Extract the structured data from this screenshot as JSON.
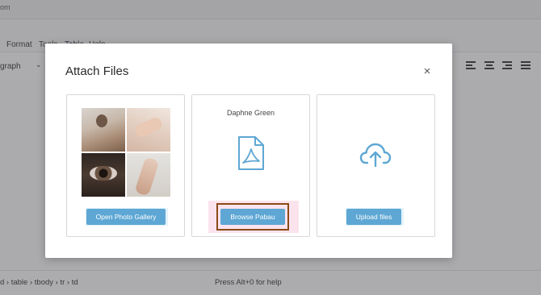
{
  "background": {
    "url_fragment": "om",
    "menus": [
      "Format",
      "Tools",
      "Table",
      "Help"
    ],
    "paragraph_select": "graph",
    "status_path": "d › table › tbody › tr › td",
    "status_help": "Press Alt+0 for help"
  },
  "modal": {
    "title": "Attach Files",
    "close_label": "×",
    "gallery_button": "Open Photo Gallery",
    "pabau_user": "Daphne Green",
    "pabau_button": "Browse Pabau",
    "upload_button": "Upload files"
  },
  "colors": {
    "button": "#5ea7d4",
    "icon": "#5ea7d4",
    "highlight_border": "#8a4a16"
  }
}
